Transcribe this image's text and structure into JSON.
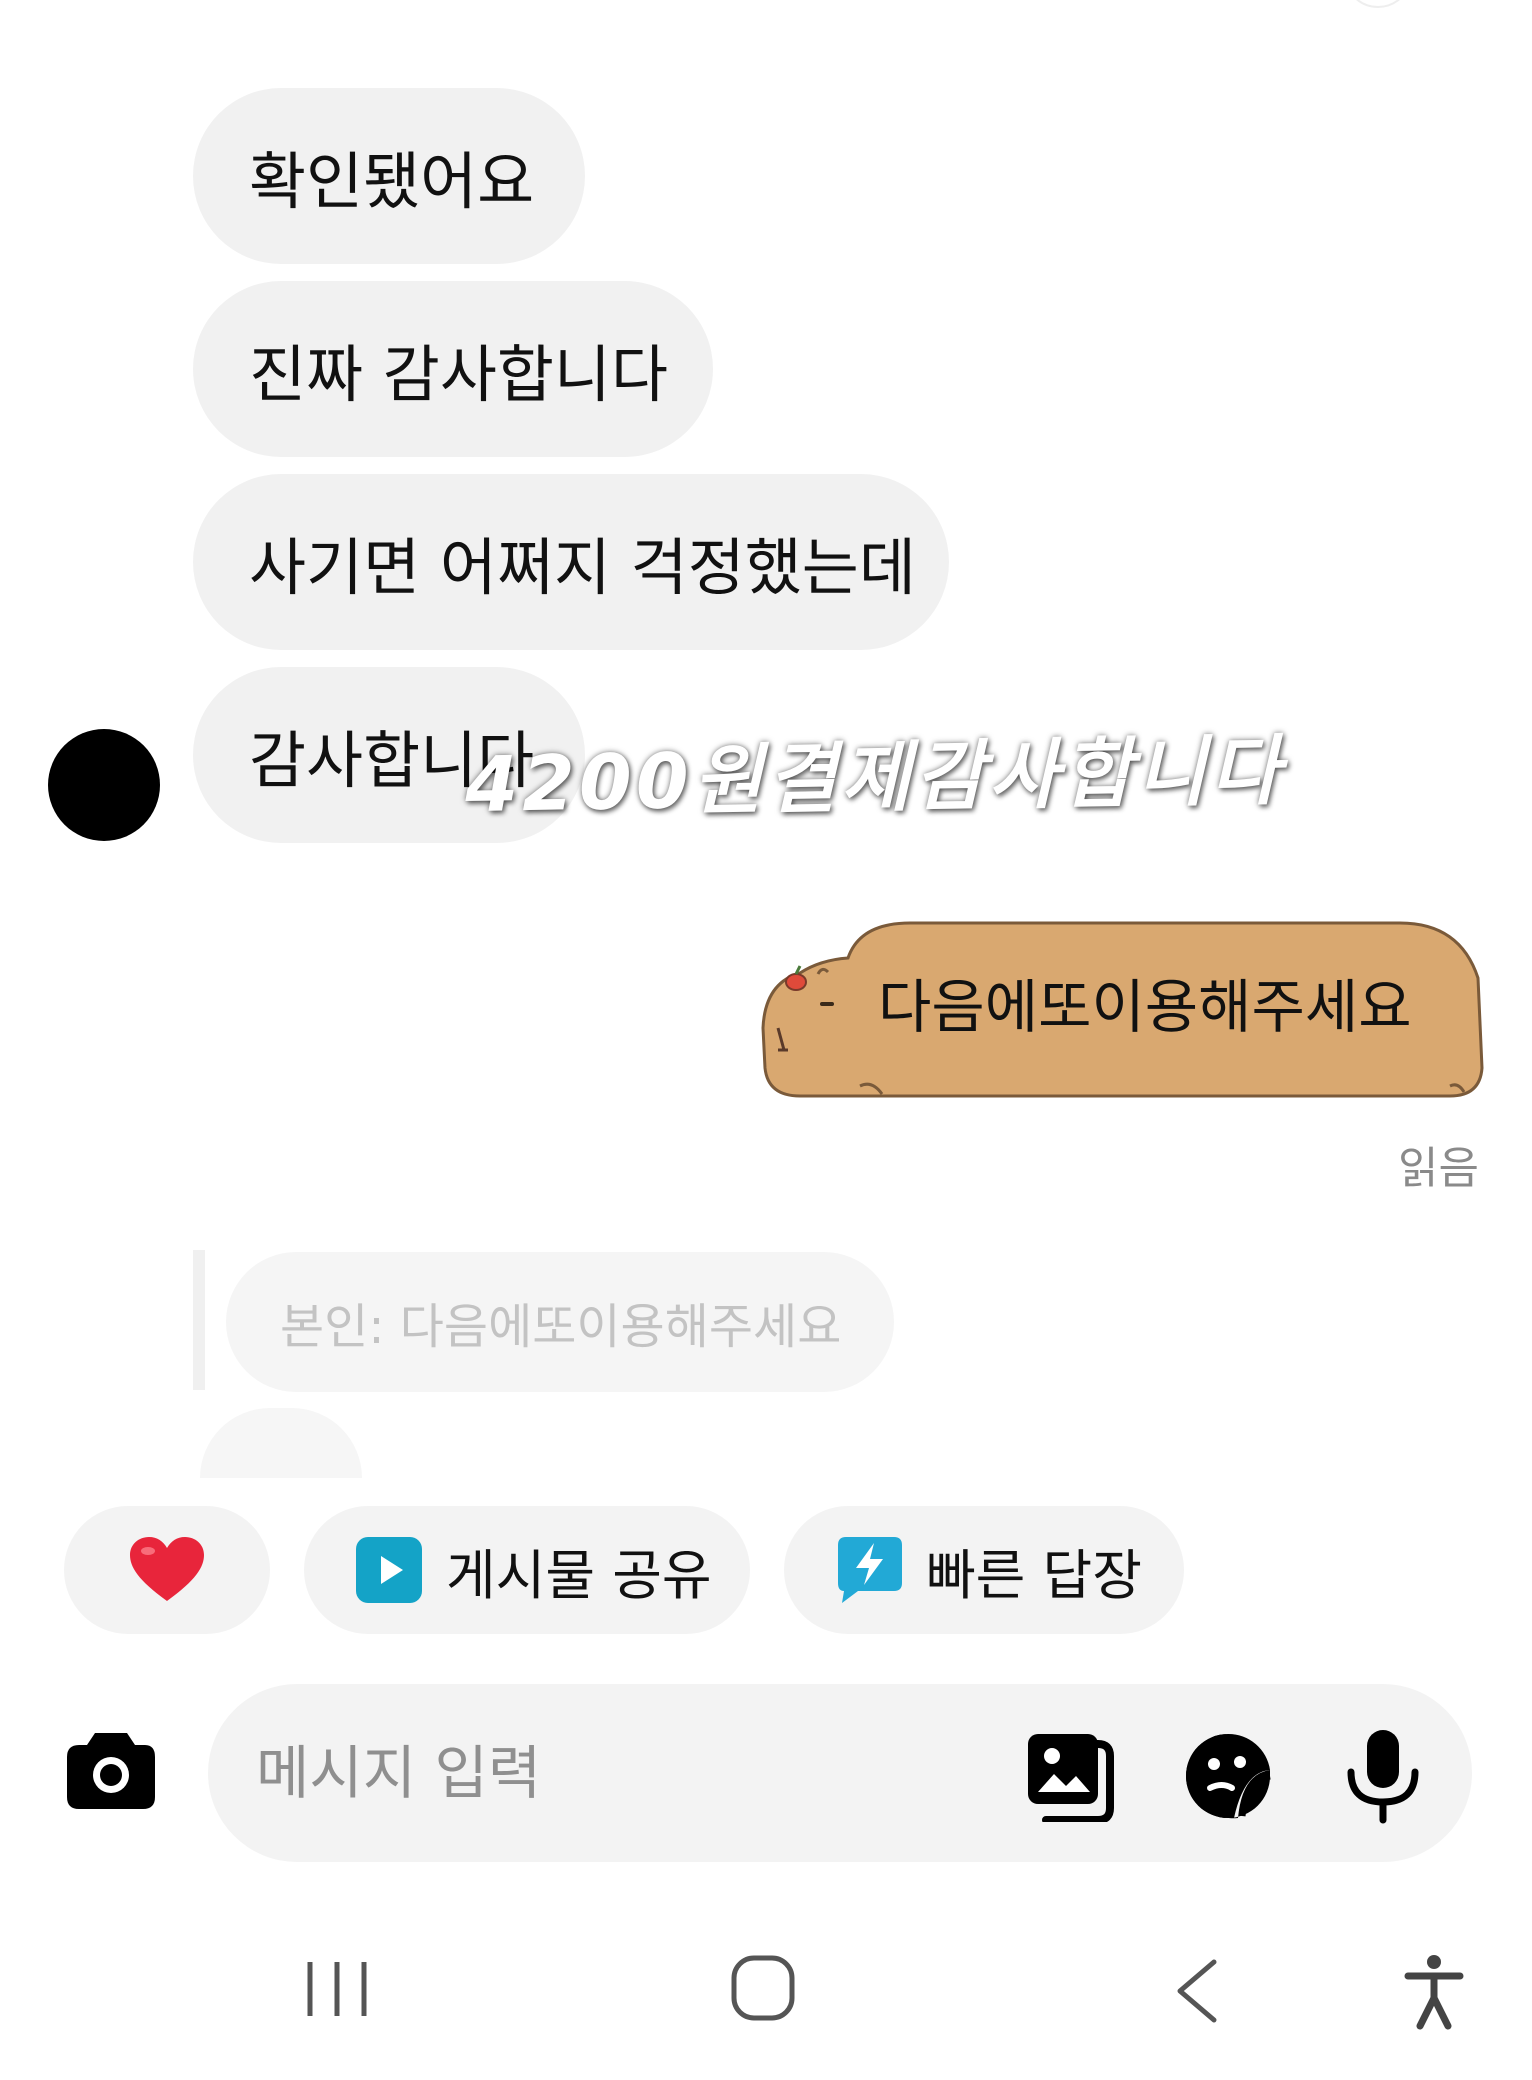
{
  "messages": [
    {
      "text": "확인됐어요"
    },
    {
      "text": "진짜 감사합니다"
    },
    {
      "text": "사기면 어쩌지 걱정했는데"
    },
    {
      "text": "감사합니다"
    }
  ],
  "overlay_text": "4200원결제감사합니다",
  "sent_sticker": {
    "text": "다음에또이용해주세요",
    "icon": "capybara-sticker"
  },
  "read_receipt": "읽음",
  "reply_preview": "본인: 다음에또이용해주세요",
  "quick_chips": [
    {
      "icon": "heart-icon",
      "label": ""
    },
    {
      "icon": "play-icon",
      "label": "게시물 공유"
    },
    {
      "icon": "lightning-icon",
      "label": "빠른 답장"
    }
  ],
  "composer": {
    "placeholder": "메시지 입력",
    "icons": [
      "camera-icon",
      "gallery-icon",
      "sticker-icon",
      "microphone-icon"
    ]
  },
  "nav": {
    "icons": [
      "recent-apps-icon",
      "home-icon",
      "back-icon",
      "accessibility-icon"
    ]
  },
  "colors": {
    "bubble_bg": "#f1f1f1",
    "sticker_fill": "#d9a870",
    "heart": "#e8253b",
    "play_accent": "#14a3c7",
    "lightning_accent": "#22a9d6"
  }
}
